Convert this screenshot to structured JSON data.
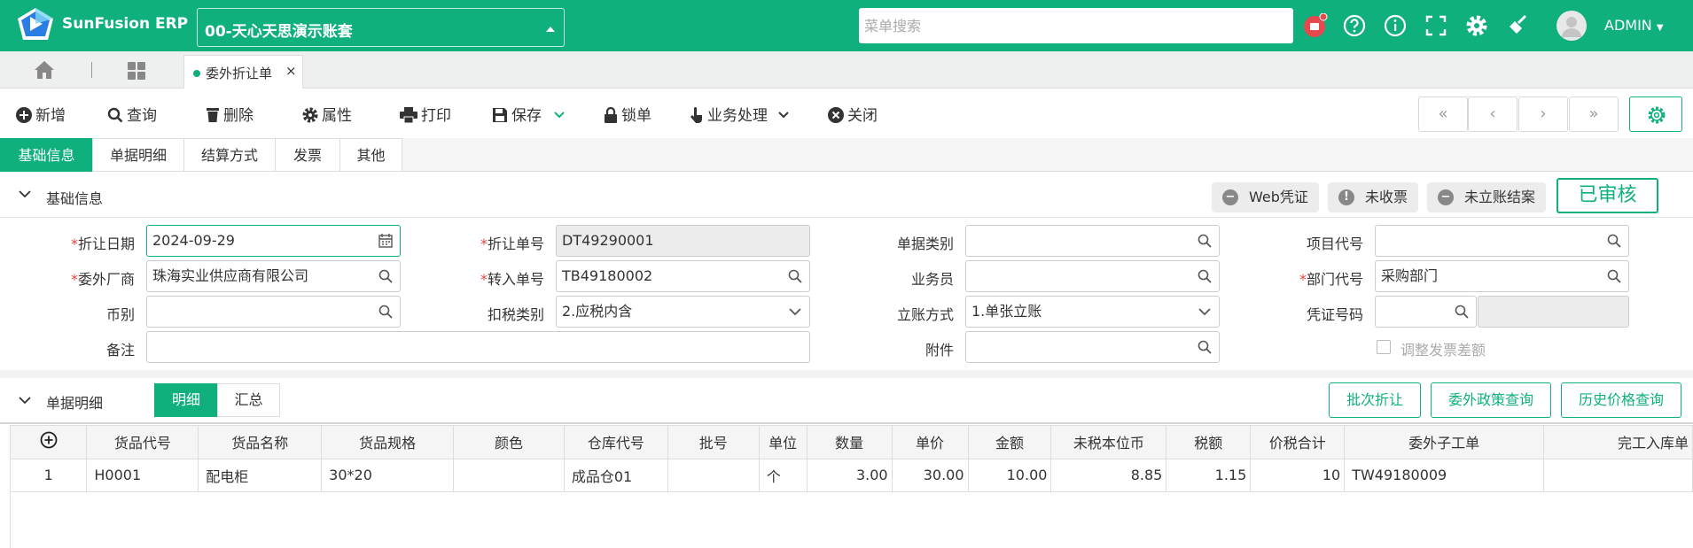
{
  "app": {
    "brand": "SunFusion ERP",
    "account": "00-天心天思演示账套",
    "search_placeholder": "菜单搜索",
    "user": "ADMIN"
  },
  "colors": {
    "primary": "#0fb07d",
    "required": "#e0463f",
    "notify": "#e5484d"
  },
  "icons": [
    "bell-icon",
    "help-icon",
    "info-icon",
    "fullscreen-icon",
    "gear-icon",
    "broom-icon",
    "home-icon",
    "grid-icon"
  ],
  "tabstrip": {
    "active_tab": "委外折让单",
    "close": "×"
  },
  "toolbar": {
    "new": "新增",
    "query": "查询",
    "delete": "删除",
    "props": "属性",
    "print": "打印",
    "save": "保存",
    "lock": "锁单",
    "business": "业务处理",
    "close": "关闭",
    "nav": {
      "first": "«",
      "prev": "‹",
      "next": "›",
      "last": "»"
    }
  },
  "subtabs": [
    "基础信息",
    "单据明细",
    "结算方式",
    "发票",
    "其他"
  ],
  "basic": {
    "title": "基础信息",
    "badges": {
      "web_voucher": "Web凭证",
      "not_received": "未收票",
      "not_closed": "未立账结案"
    },
    "status": "已审核",
    "fields": {
      "date_label": "折让日期",
      "date_value": "2024-09-29",
      "no_label": "折让单号",
      "no_value": "DT49290001",
      "type_label": "单据类别",
      "type_value": "",
      "project_label": "项目代号",
      "project_value": "",
      "vendor_label": "委外厂商",
      "vendor_value": "珠海实业供应商有限公司",
      "in_no_label": "转入单号",
      "in_no_value": "TB49180002",
      "staff_label": "业务员",
      "staff_value": "",
      "dept_label": "部门代号",
      "dept_value": "采购部门",
      "currency_label": "币别",
      "currency_value": "",
      "tax_label": "扣税类别",
      "tax_value": "2.应税内含",
      "acct_label": "立账方式",
      "acct_value": "1.单张立账",
      "voucher_label": "凭证号码",
      "voucher_value": "",
      "note_label": "备注",
      "note_value": "",
      "attach_label": "附件",
      "attach_value": "",
      "adjust_label": "调整发票差额"
    }
  },
  "detail": {
    "title": "单据明细",
    "seg": {
      "detail": "明细",
      "summary": "汇总"
    },
    "buttons": {
      "batch": "批次折让",
      "policy": "委外政策查询",
      "history": "历史价格查询"
    },
    "columns": [
      "货品代号",
      "货品名称",
      "货品规格",
      "颜色",
      "仓库代号",
      "批号",
      "单位",
      "数量",
      "单价",
      "金额",
      "未税本位币",
      "税额",
      "价税合计",
      "委外子工单",
      "完工入库单"
    ],
    "rows": [
      {
        "no": "1",
        "code": "H0001",
        "name": "配电柜",
        "spec": "30*20",
        "color": "",
        "wh": "成品仓01",
        "batch": "",
        "unit": "个",
        "qty": "3.00",
        "price": "30.00",
        "amount": "10.00",
        "untaxed": "8.85",
        "tax": "1.15",
        "total": "10",
        "sub_order": "TW49180009",
        "done": ""
      }
    ]
  }
}
